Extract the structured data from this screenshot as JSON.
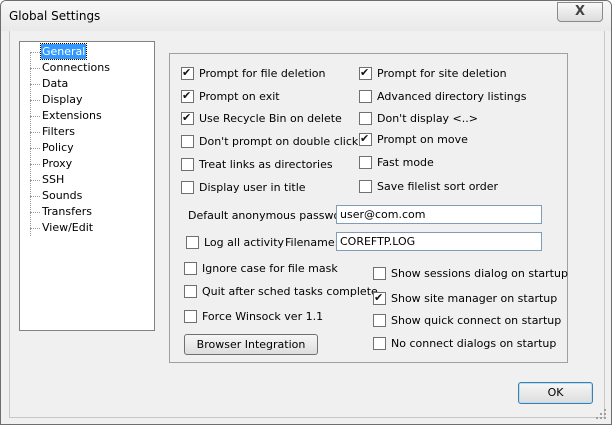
{
  "window": {
    "title": "Global Settings",
    "close_label": "X"
  },
  "tree": {
    "items": [
      {
        "label": "General",
        "selected": true
      },
      {
        "label": "Connections"
      },
      {
        "label": "Data"
      },
      {
        "label": "Display"
      },
      {
        "label": "Extensions"
      },
      {
        "label": "Filters"
      },
      {
        "label": "Policy"
      },
      {
        "label": "Proxy"
      },
      {
        "label": "SSH"
      },
      {
        "label": "Sounds"
      },
      {
        "label": "Transfers"
      },
      {
        "label": "View/Edit"
      }
    ]
  },
  "general": {
    "left_checks": [
      {
        "label": "Prompt for file deletion",
        "checked": true
      },
      {
        "label": "Prompt on exit",
        "checked": true
      },
      {
        "label": "Use Recycle Bin on delete",
        "checked": true
      },
      {
        "label": "Don't prompt on double click",
        "checked": false
      },
      {
        "label": "Treat links as directories",
        "checked": false
      },
      {
        "label": "Display user in title",
        "checked": false
      }
    ],
    "right_checks": [
      {
        "label": "Prompt for site deletion",
        "checked": true
      },
      {
        "label": "Advanced directory listings",
        "checked": false
      },
      {
        "label": "Don't display <..>",
        "checked": false
      },
      {
        "label": "Prompt on move",
        "checked": true
      },
      {
        "label": "Fast mode",
        "checked": false
      },
      {
        "label": "Save filelist sort order",
        "checked": false
      }
    ],
    "anon_password_label": "Default anonymous password:",
    "anon_password_value": "user@com.com",
    "log_all_label": "Log all activity",
    "log_all_checked": false,
    "filename_label": "Filename:",
    "filename_value": "COREFTP.LOG",
    "lower_left_checks": [
      {
        "label": "Ignore case for file mask",
        "checked": false
      },
      {
        "label": "Quit after sched tasks complete",
        "checked": false
      },
      {
        "label": "Force Winsock ver 1.1",
        "checked": false
      }
    ],
    "lower_right_checks": [
      {
        "label": "Show sessions dialog on startup",
        "checked": false
      },
      {
        "label": "Show site manager on startup",
        "checked": true
      },
      {
        "label": "Show quick connect on startup",
        "checked": false
      },
      {
        "label": "No connect dialogs on startup",
        "checked": false
      }
    ],
    "browser_integration_label": "Browser Integration"
  },
  "ok_label": "OK"
}
